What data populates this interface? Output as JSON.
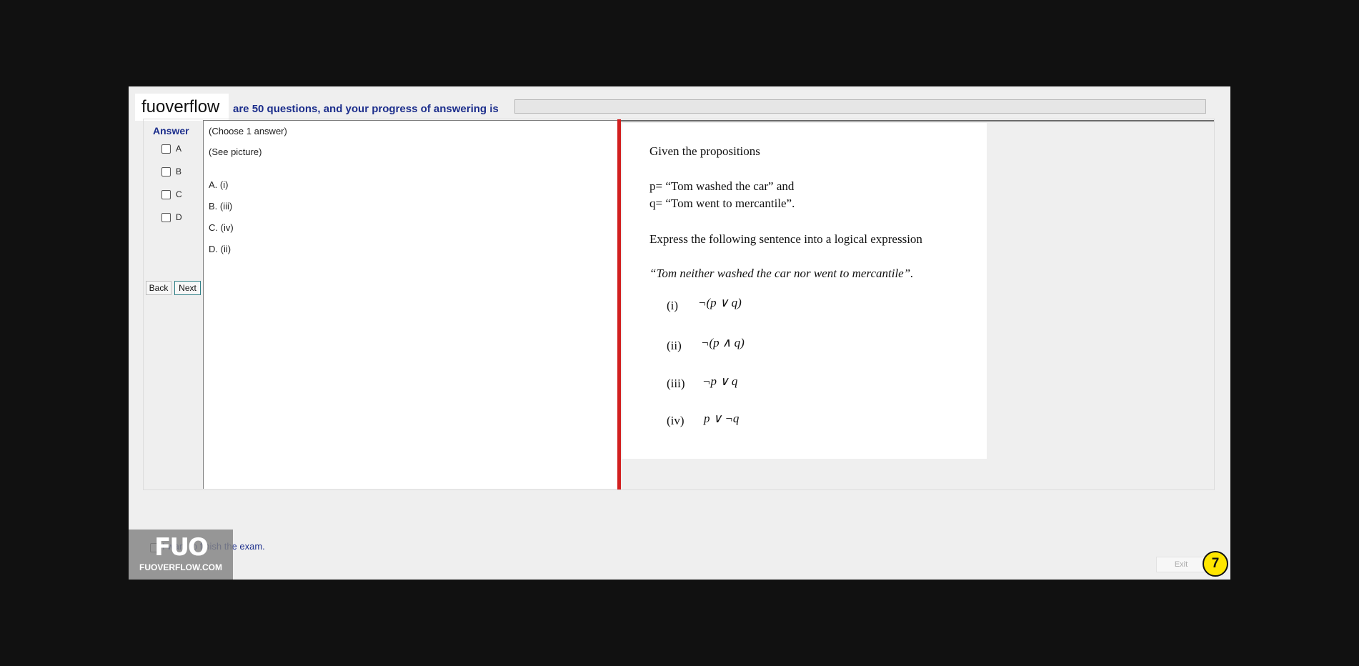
{
  "header": {
    "brand": "fuoverflow",
    "progress_text": "are 50 questions, and your progress of answering is",
    "progress_fraction": 0
  },
  "answer_panel": {
    "title": "Answer",
    "options": [
      "A",
      "B",
      "C",
      "D"
    ],
    "back_label": "Back",
    "next_label": "Next"
  },
  "question": {
    "instruction": "(Choose 1 answer)",
    "see_picture": "(See picture)",
    "choices": [
      "A.  (i)",
      "B.  (iii)",
      "C.  (iv)",
      "D.  (ii)"
    ]
  },
  "picture": {
    "line1": "Given the propositions",
    "line2": "p= “Tom washed the car” and",
    "line3": "q= “Tom went to mercantile”.",
    "line4": "Express the following sentence into a logical expression",
    "line5": "“Tom neither washed the car nor went to mercantile”.",
    "items": [
      {
        "label": "(i)",
        "expr": "¬(p ∨ q)"
      },
      {
        "label": "(ii)",
        "expr": "¬(p ∧ q)"
      },
      {
        "label": "(iii)",
        "expr": "¬p ∨ q"
      },
      {
        "label": "(iv)",
        "expr": "p ∨ ¬q"
      }
    ]
  },
  "footer": {
    "finish_text": "I want to finish the exam.",
    "watermark_big": "FUO",
    "watermark_small": "FUOVERFLOW.COM",
    "exit_label": "Exit",
    "counter": "7"
  },
  "colors": {
    "label_blue": "#1c2e8c",
    "divider_red": "#d21f1f",
    "counter_yellow": "#ffe600"
  }
}
